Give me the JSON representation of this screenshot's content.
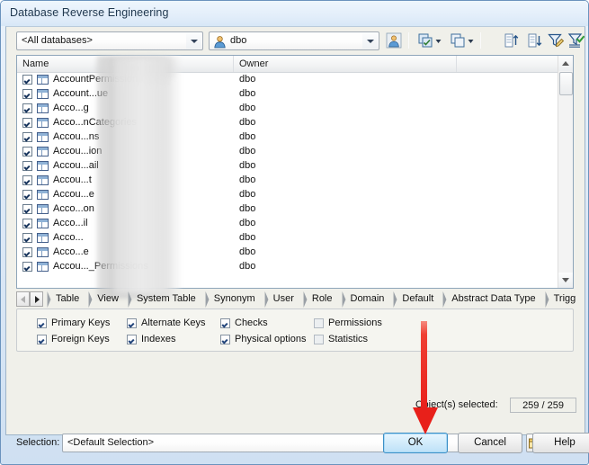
{
  "window": {
    "title": "Database Reverse Engineering",
    "accent_color": "#3c8fc6",
    "frame_color": "#6b93bd"
  },
  "toolbar": {
    "database_combo": {
      "value": "<All databases>",
      "placeholder": "<All databases>"
    },
    "owner_combo": {
      "value": "dbo",
      "placeholder": "dbo",
      "icon": "user-icon"
    },
    "buttons": [
      {
        "name": "select-owner-button",
        "icon": "user-filter-icon",
        "tooltip": "Owner"
      },
      {
        "name": "select-all-button",
        "icon": "select-all-icon",
        "tooltip": "Select All"
      },
      {
        "name": "deselect-all-button",
        "icon": "deselect-all-icon",
        "tooltip": "Deselect All"
      },
      {
        "name": "sort-ascending-button",
        "icon": "sort-ascending-icon",
        "tooltip": "Sort Ascending"
      },
      {
        "name": "sort-descending-button",
        "icon": "sort-descending-icon",
        "tooltip": "Sort Descending"
      },
      {
        "name": "edit-filter-button",
        "icon": "funnel-edit-icon",
        "tooltip": "Edit Filter"
      },
      {
        "name": "apply-filter-button",
        "icon": "funnel-check-icon",
        "tooltip": "Apply Filter"
      }
    ]
  },
  "list": {
    "columns": [
      "Name",
      "Owner"
    ],
    "rows": [
      {
        "checked": true,
        "name": "AccountPermission",
        "owner": "dbo",
        "masked": true
      },
      {
        "checked": true,
        "name": "Account...ue",
        "owner": "dbo",
        "masked": true
      },
      {
        "checked": true,
        "name": "Acco...g",
        "owner": "dbo",
        "masked": true
      },
      {
        "checked": true,
        "name": "Acco...nCategories",
        "owner": "dbo",
        "masked": true
      },
      {
        "checked": true,
        "name": "Accou...ns",
        "owner": "dbo",
        "masked": true
      },
      {
        "checked": true,
        "name": "Accou...ion",
        "owner": "dbo",
        "masked": true
      },
      {
        "checked": true,
        "name": "Accou...ail",
        "owner": "dbo",
        "masked": true
      },
      {
        "checked": true,
        "name": "Accou...t",
        "owner": "dbo",
        "masked": true
      },
      {
        "checked": true,
        "name": "Accou...e",
        "owner": "dbo",
        "masked": true
      },
      {
        "checked": true,
        "name": "Acco...on",
        "owner": "dbo",
        "masked": true
      },
      {
        "checked": true,
        "name": "Acco...il",
        "owner": "dbo",
        "masked": true
      },
      {
        "checked": true,
        "name": "Acco...",
        "owner": "dbo",
        "masked": true
      },
      {
        "checked": true,
        "name": "Acco...e",
        "owner": "dbo",
        "masked": true
      },
      {
        "checked": true,
        "name": "Accou..._Permissions",
        "owner": "dbo",
        "masked": true
      }
    ]
  },
  "tabs": {
    "prev_label": "◄",
    "next_label": "►",
    "items": [
      {
        "label": "Table",
        "active": true
      },
      {
        "label": "View",
        "active": false
      },
      {
        "label": "System Table",
        "active": false
      },
      {
        "label": "Synonym",
        "active": false
      },
      {
        "label": "User",
        "active": false
      },
      {
        "label": "Role",
        "active": false
      },
      {
        "label": "Domain",
        "active": false
      },
      {
        "label": "Default",
        "active": false
      },
      {
        "label": "Abstract Data Type",
        "active": false
      },
      {
        "label": "Trigg",
        "active": false
      }
    ]
  },
  "options": [
    {
      "label": "Primary Keys",
      "checked": true
    },
    {
      "label": "Foreign Keys",
      "checked": true
    },
    {
      "label": "Alternate Keys",
      "checked": true
    },
    {
      "label": "Indexes",
      "checked": true
    },
    {
      "label": "Checks",
      "checked": true
    },
    {
      "label": "Physical options",
      "checked": true
    },
    {
      "label": "Permissions",
      "checked": false
    },
    {
      "label": "Statistics",
      "checked": false
    }
  ],
  "object_count": {
    "label": "Object(s) selected:",
    "value": "259 / 259"
  },
  "selection": {
    "label": "Selection:",
    "value": "<Default Selection>",
    "buttons": [
      {
        "name": "open-selection-button",
        "icon": "folder-open-icon"
      },
      {
        "name": "save-selection-button",
        "icon": "floppy-save-icon"
      },
      {
        "name": "delete-selection-button",
        "icon": "close-x-icon"
      }
    ]
  },
  "dialog_buttons": {
    "ok": "OK",
    "cancel": "Cancel",
    "help": "Help"
  },
  "annotation": {
    "type": "red-down-arrow",
    "color": "#ee2b20",
    "points_to": "OK"
  }
}
